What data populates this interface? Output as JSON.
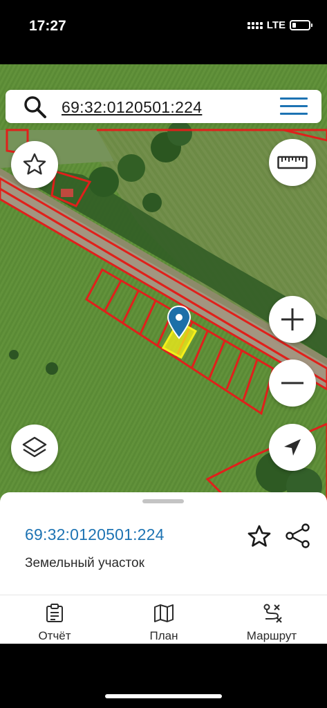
{
  "status_bar": {
    "time": "17:27",
    "network": "LTE"
  },
  "search": {
    "query": "69:32:0120501:224",
    "icon": "search-icon",
    "menu_icon": "hamburger-menu-icon"
  },
  "map": {
    "boundary_color": "#e0201b",
    "selected_parcel_color": "#f5ef1a",
    "marker_color": "#1d6fa8",
    "controls": {
      "favorite_icon": "star-outline-icon",
      "ruler_icon": "ruler-icon",
      "layers_icon": "layers-icon",
      "zoom_in_icon": "plus-icon",
      "zoom_out_icon": "minus-icon",
      "locate_icon": "navigation-arrow-icon"
    }
  },
  "parcel": {
    "number": "69:32:0120501:224",
    "type": "Земельный участок"
  },
  "tabs": [
    {
      "label": "Отчёт",
      "icon": "clipboard-icon"
    },
    {
      "label": "План",
      "icon": "map-icon"
    },
    {
      "label": "Маршрут",
      "icon": "route-icon"
    }
  ],
  "accent_color": "#1d73b3"
}
